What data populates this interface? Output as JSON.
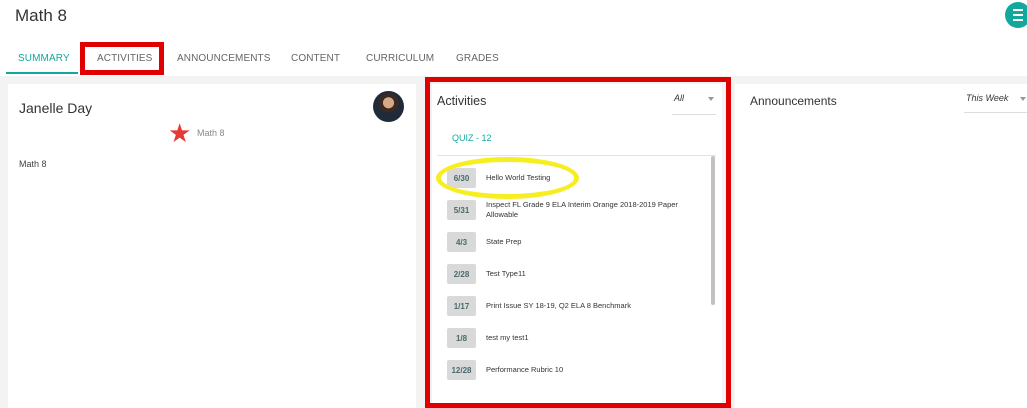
{
  "page": {
    "title": "Math 8"
  },
  "tabs": [
    {
      "label": "SUMMARY",
      "active": true
    },
    {
      "label": "ACTIVITIES",
      "active": false
    },
    {
      "label": "ANNOUNCEMENTS",
      "active": false
    },
    {
      "label": "CONTENT",
      "active": false
    },
    {
      "label": "CURRICULUM",
      "active": false
    },
    {
      "label": "GRADES",
      "active": false
    }
  ],
  "summary": {
    "teacher_name": "Janelle Day",
    "course_label": "Math 8",
    "course_text": "Math 8"
  },
  "activities": {
    "title": "Activities",
    "filter_value": "All",
    "quiz_tab": "QUIZ - 12",
    "items": [
      {
        "date": "6/30",
        "name": "Hello World Testing"
      },
      {
        "date": "5/31",
        "name": "Inspect FL Grade 9 ELA Interim Orange 2018-2019 Paper Allowable"
      },
      {
        "date": "4/3",
        "name": "State Prep"
      },
      {
        "date": "2/28",
        "name": "Test Type11"
      },
      {
        "date": "1/17",
        "name": "Print Issue SY 18-19, Q2 ELA 8 Benchmark"
      },
      {
        "date": "1/8",
        "name": "test my test1"
      },
      {
        "date": "12/28",
        "name": "Performance Rubric 10"
      }
    ]
  },
  "announcements": {
    "title": "Announcements",
    "filter_value": "This Week"
  },
  "colors": {
    "accent": "#13a89e",
    "highlight_red": "#e00000",
    "highlight_yellow": "#f7ee22",
    "star": "#e53935"
  },
  "icons": [
    "menu-icon",
    "star-icon",
    "avatar",
    "chevron-down-icon"
  ]
}
